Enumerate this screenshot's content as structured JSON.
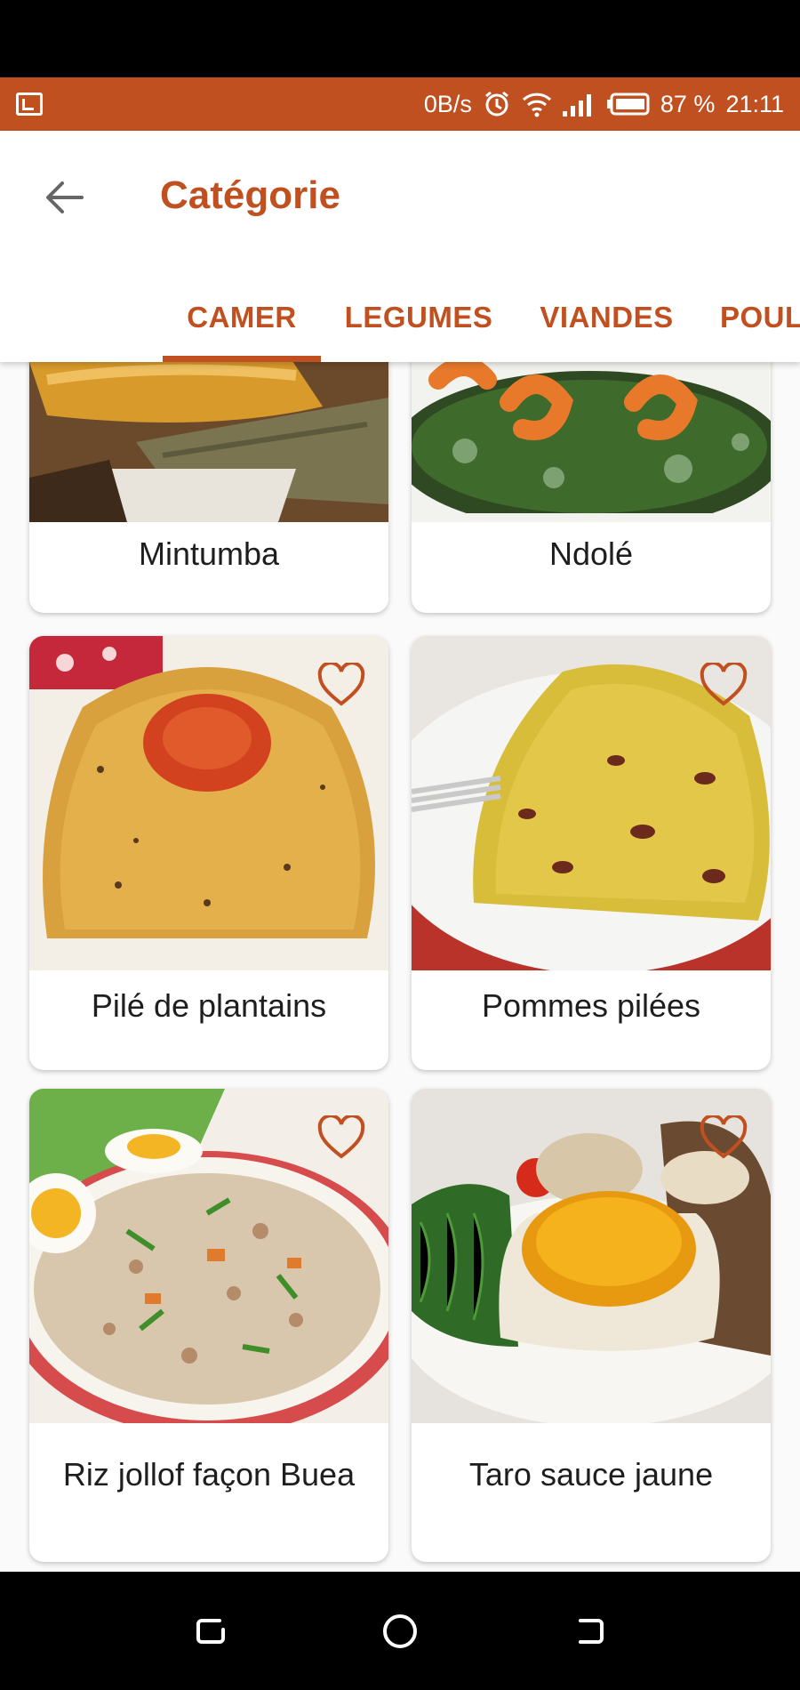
{
  "status_bar": {
    "network_speed": "0B/s",
    "battery": "87 %",
    "time": "21:11",
    "color": "#c0501f"
  },
  "app_bar": {
    "title": "Catégorie",
    "accent": "#c0501f"
  },
  "tabs": [
    {
      "label": "CAMER",
      "active": true
    },
    {
      "label": "LEGUMES",
      "active": false
    },
    {
      "label": "VIANDES",
      "active": false
    },
    {
      "label": "POUL",
      "active": false
    }
  ],
  "recipes": [
    {
      "name": "Mintumba",
      "icon": "dish-photo"
    },
    {
      "name": "Ndolé",
      "icon": "dish-photo"
    },
    {
      "name": "Pilé de plantains",
      "icon": "dish-photo",
      "favorite_icon": "heart-outline-icon"
    },
    {
      "name": "Pommes pilées",
      "icon": "dish-photo",
      "favorite_icon": "heart-outline-icon"
    },
    {
      "name": "Riz jollof façon Buea",
      "icon": "dish-photo",
      "favorite_icon": "heart-outline-icon"
    },
    {
      "name": "Taro sauce jaune",
      "icon": "dish-photo",
      "favorite_icon": "heart-outline-icon"
    }
  ]
}
